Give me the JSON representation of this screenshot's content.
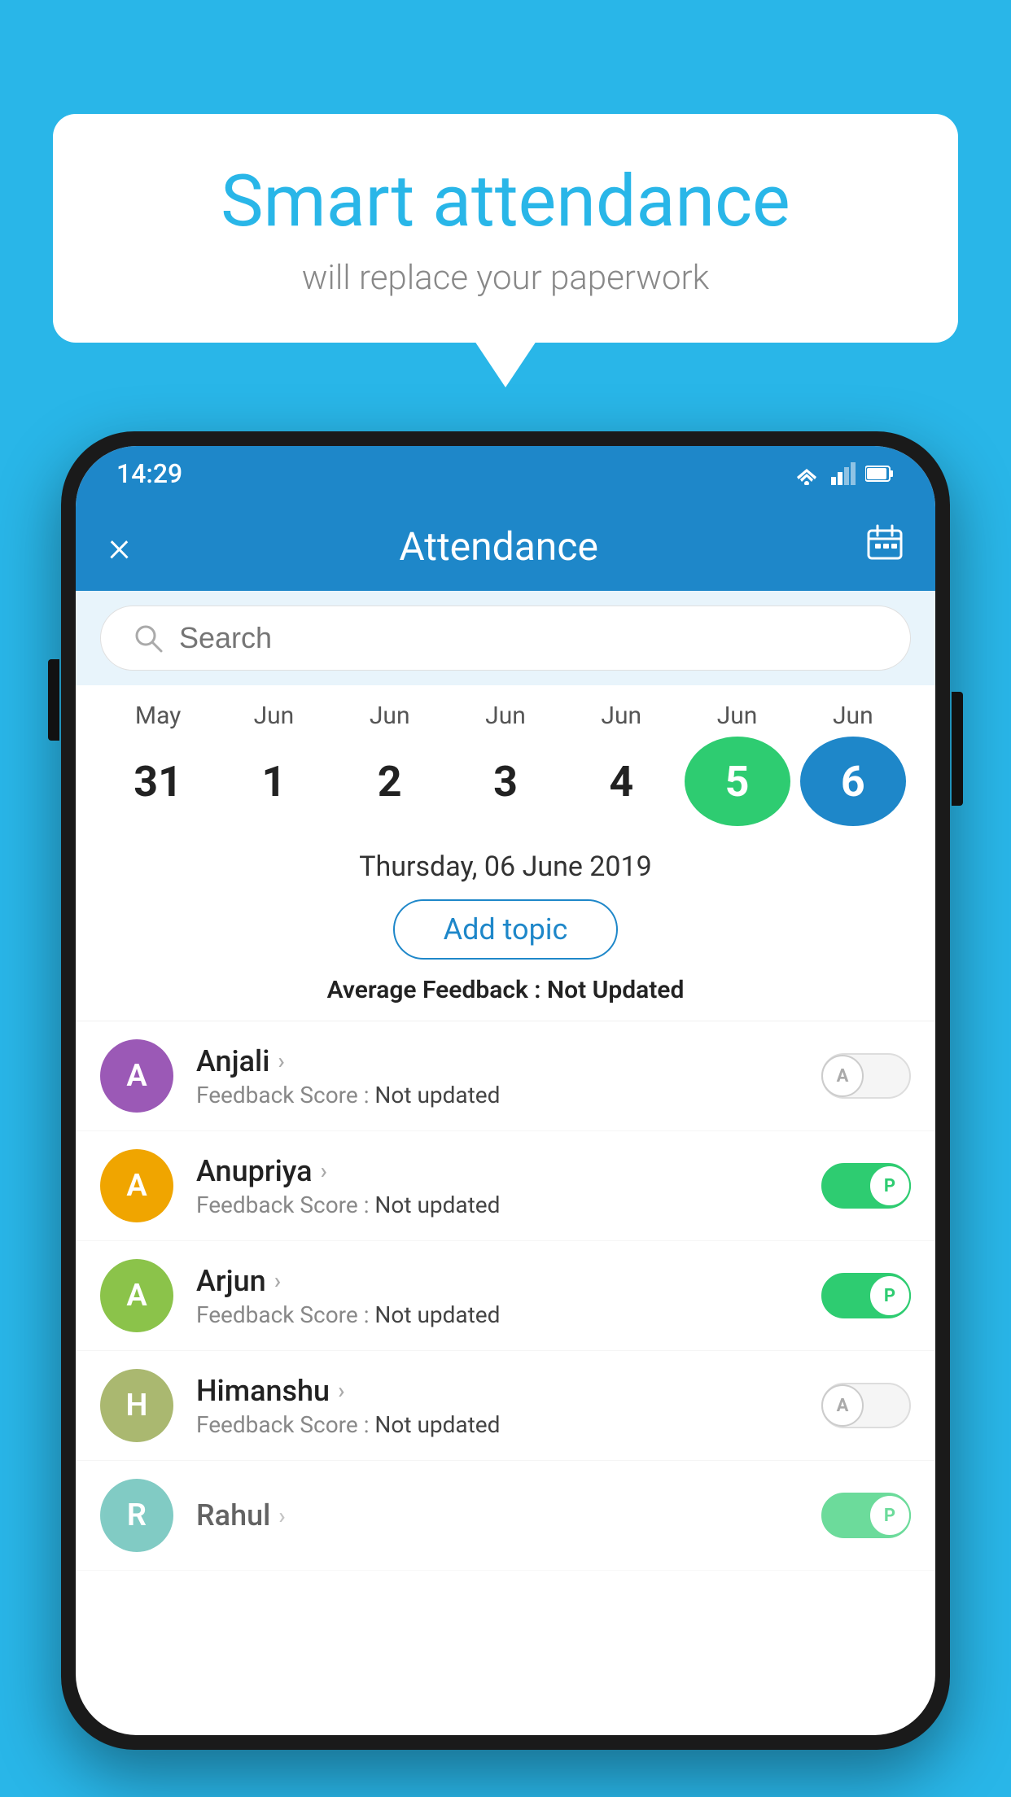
{
  "background_color": "#29b6e8",
  "speech_bubble": {
    "title": "Smart attendance",
    "subtitle": "will replace your paperwork"
  },
  "status_bar": {
    "time": "14:29"
  },
  "app_bar": {
    "title": "Attendance",
    "close_label": "×",
    "calendar_label": "📅"
  },
  "search": {
    "placeholder": "Search"
  },
  "calendar": {
    "months": [
      "May",
      "Jun",
      "Jun",
      "Jun",
      "Jun",
      "Jun",
      "Jun"
    ],
    "dates": [
      "31",
      "1",
      "2",
      "3",
      "4",
      "5",
      "6"
    ],
    "states": [
      "normal",
      "normal",
      "normal",
      "normal",
      "normal",
      "today",
      "selected"
    ]
  },
  "date_display": {
    "label": "Thursday, 06 June 2019",
    "add_topic_btn": "Add topic",
    "avg_feedback_label": "Average Feedback : ",
    "avg_feedback_value": "Not Updated"
  },
  "students": [
    {
      "name": "Anjali",
      "initial": "A",
      "avatar_color": "#9b59b6",
      "feedback_label": "Feedback Score : ",
      "feedback_value": "Not updated",
      "toggle_state": "off",
      "toggle_letter": "A"
    },
    {
      "name": "Anupriya",
      "initial": "A",
      "avatar_color": "#f0a500",
      "feedback_label": "Feedback Score : ",
      "feedback_value": "Not updated",
      "toggle_state": "on",
      "toggle_letter": "P"
    },
    {
      "name": "Arjun",
      "initial": "A",
      "avatar_color": "#8bc34a",
      "feedback_label": "Feedback Score : ",
      "feedback_value": "Not updated",
      "toggle_state": "on",
      "toggle_letter": "P"
    },
    {
      "name": "Himanshu",
      "initial": "H",
      "avatar_color": "#aab870",
      "feedback_label": "Feedback Score : ",
      "feedback_value": "Not updated",
      "toggle_state": "off",
      "toggle_letter": "A"
    }
  ]
}
